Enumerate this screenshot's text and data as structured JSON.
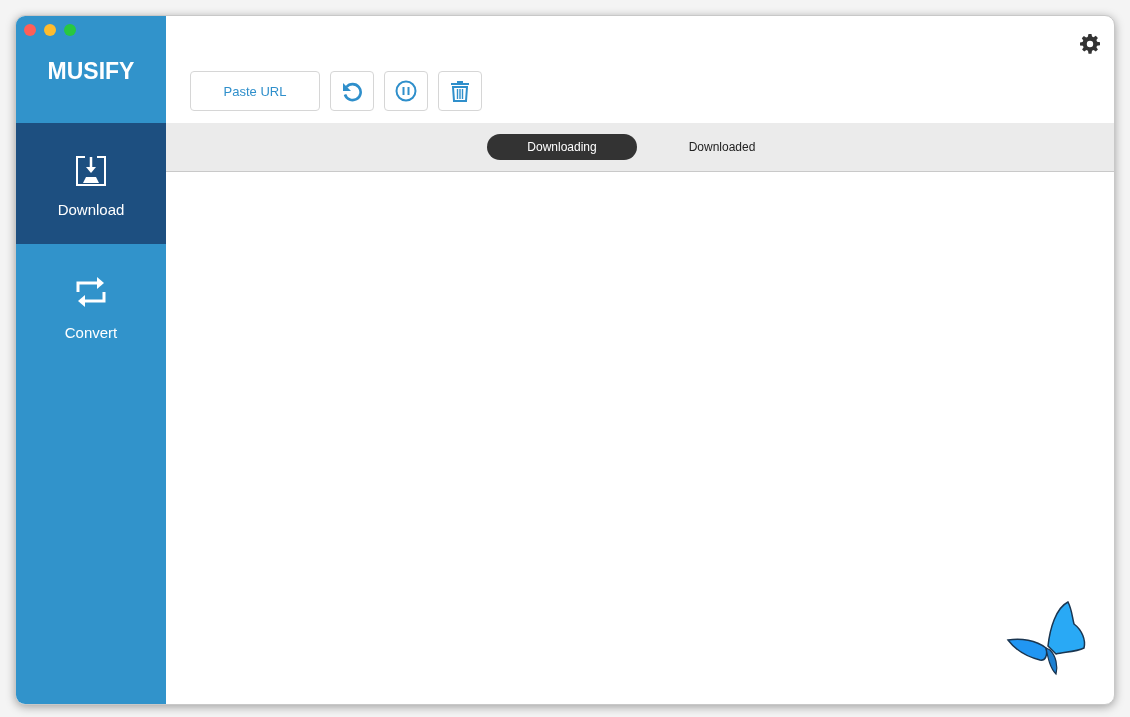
{
  "app": {
    "title": "MUSIFY"
  },
  "sidebar": {
    "items": [
      {
        "label": "Download",
        "kind": "download",
        "selected": true
      },
      {
        "label": "Convert",
        "kind": "convert",
        "selected": false
      }
    ]
  },
  "toolbar": {
    "paste_button": "Paste URL"
  },
  "tabs": [
    {
      "label": "Downloading",
      "selected": true
    },
    {
      "label": "Downloaded",
      "selected": false
    }
  ]
}
